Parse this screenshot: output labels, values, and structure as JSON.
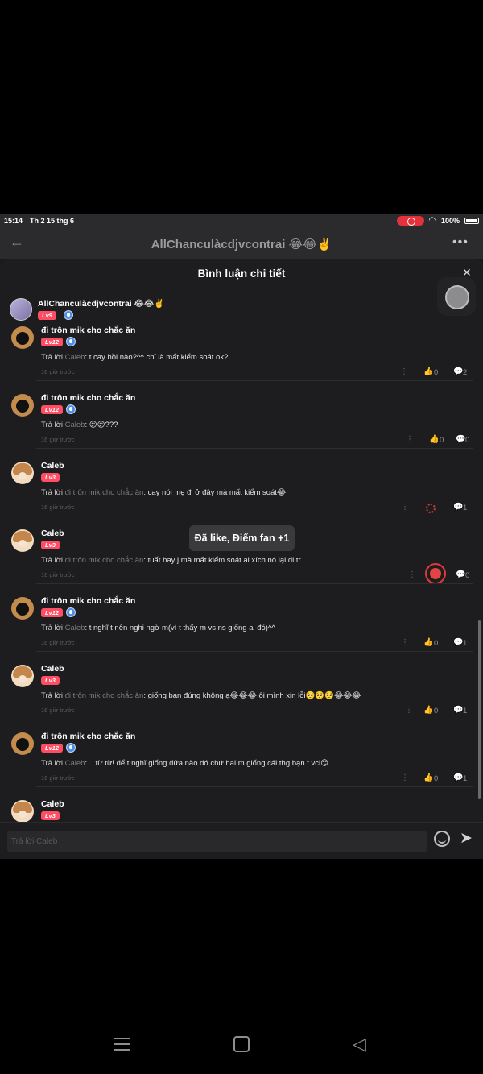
{
  "status_bar": {
    "time": "15:14",
    "date": "Th 2 15 thg 6",
    "battery": "100%",
    "wifi_icon": "wifi-icon"
  },
  "app_header": {
    "title": "AllChanculàcdjvcontrai 😂😂✌️",
    "back_icon": "arrow-left-icon",
    "more_icon": "ellipsis-icon"
  },
  "sheet": {
    "title": "Bình luận chi tiết",
    "close_icon": "close-icon"
  },
  "main_comment": {
    "username": "AllChanculàcdjvcontrai 😂😂✌️",
    "level": "Lv9"
  },
  "replies": [
    {
      "username": "đi trôn mik cho chắc ăn",
      "level": "Lv12",
      "verified": true,
      "prefix": "Trả lời ",
      "target": "Caleb",
      "text": ": t cay hồi nào?^^ chỉ là mất kiểm soát ok?",
      "time": "16 giờ trước",
      "likes": "0",
      "replies_count": "2"
    },
    {
      "username": "đi trôn mik cho chắc ăn",
      "level": "Lv12",
      "verified": true,
      "prefix": "Trả lời ",
      "target": "Caleb",
      "text": ": 😕😕???",
      "time": "16 giờ trước",
      "likes": "0",
      "replies_count": "0"
    },
    {
      "username": "Caleb",
      "level": "Lv3",
      "verified": false,
      "prefix": "Trả lời ",
      "target": "đi trôn mik cho chắc ăn",
      "text": ": cay nói mẹ đi ở đây mà mất kiểm soát😂",
      "time": "16 giờ trước",
      "likes": "",
      "replies_count": "1"
    },
    {
      "username": "Caleb",
      "level": "Lv3",
      "verified": false,
      "prefix": "Trả lời ",
      "target": "đi trôn mik cho chắc ăn",
      "text": ": tuất hay j mà mất kiểm soát ai xích nó lại đi tr",
      "time": "16 giờ trước",
      "likes": "",
      "replies_count": "0"
    },
    {
      "username": "đi trôn mik cho chắc ăn",
      "level": "Lv12",
      "verified": true,
      "prefix": "Trả lời ",
      "target": "Caleb",
      "text": ": t nghĩ t nên nghi ngờ m(vì t thấy m vs ns giống ai đó)^^",
      "time": "16 giờ trước",
      "likes": "0",
      "replies_count": "1"
    },
    {
      "username": "Caleb",
      "level": "Lv3",
      "verified": false,
      "prefix": "Trả lời ",
      "target": "đi trôn mik cho chắc ăn",
      "text": ": giống bạn đúng không ạ😂😂😂 ôi mình xin lỗi🥺🥺🥺😂😂😂",
      "time": "16 giờ trước",
      "likes": "0",
      "replies_count": "1"
    },
    {
      "username": "đi trôn mik cho chắc ăn",
      "level": "Lv12",
      "verified": true,
      "prefix": "Trả lời ",
      "target": "Caleb",
      "text": ": .. từ từ! để t nghĩ giống đứa nào đó chứ hai m giống cái thg bạn t vcl😏",
      "time": "16 giờ trước",
      "likes": "0",
      "replies_count": "1"
    },
    {
      "username": "Caleb",
      "level": "Lv3",
      "verified": false
    }
  ],
  "toast": "Đã like, Điểm fan +1",
  "input": {
    "placeholder": "Trả lời Caleb"
  },
  "colors": {
    "background": "#1d1d1f",
    "level_badge": "#ff4d63",
    "verified": "#4f8fe8",
    "like_active": "#e0393a"
  }
}
